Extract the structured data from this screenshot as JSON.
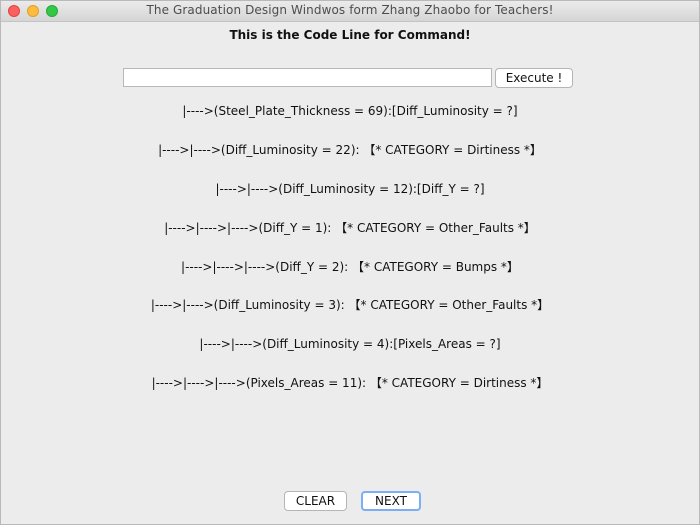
{
  "window": {
    "title": "The Graduation Design Windwos form Zhang Zhaobo for Teachers!"
  },
  "heading": "This is the Code Line for Command!",
  "command": {
    "value": "",
    "execute_label": "Execute !"
  },
  "rules": [
    "|---->(Steel_Plate_Thickness = 69):[Diff_Luminosity = ?]",
    "|---->|---->(Diff_Luminosity = 22): 【* CATEGORY = Dirtiness *】",
    "|---->|---->(Diff_Luminosity = 12):[Diff_Y = ?]",
    "|---->|---->|---->(Diff_Y = 1): 【* CATEGORY = Other_Faults *】",
    "|---->|---->|---->(Diff_Y = 2): 【* CATEGORY = Bumps *】",
    "|---->|---->(Diff_Luminosity = 3): 【* CATEGORY = Other_Faults *】",
    "|---->|---->(Diff_Luminosity = 4):[Pixels_Areas = ?]",
    "|---->|---->|---->(Pixels_Areas = 11): 【* CATEGORY = Dirtiness *】"
  ],
  "footer": {
    "clear_label": "CLEAR",
    "next_label": "NEXT"
  }
}
